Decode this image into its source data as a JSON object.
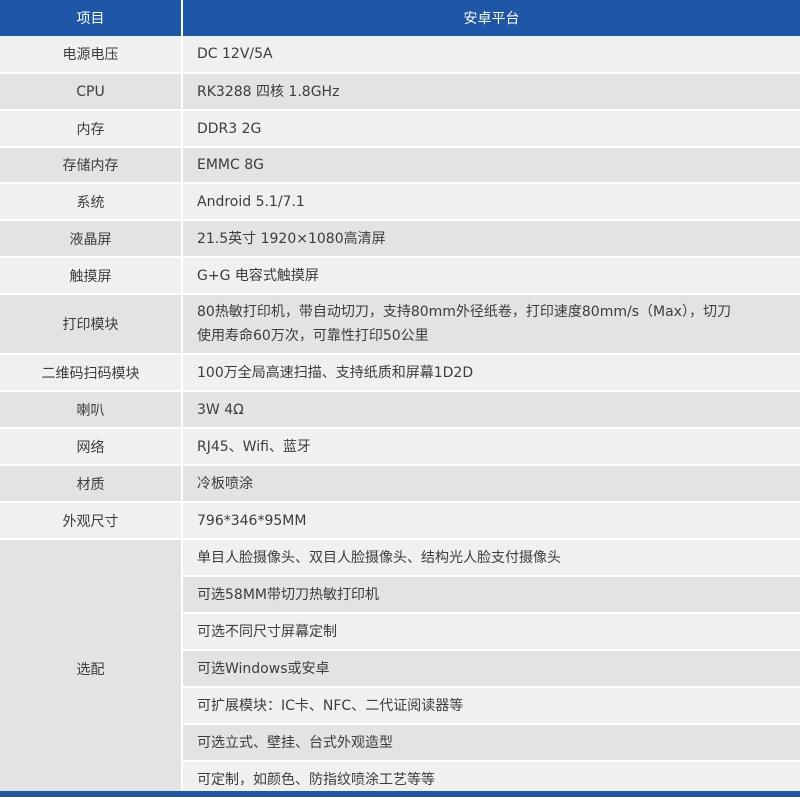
{
  "header": {
    "col1": "项目",
    "col2": "安卓平台"
  },
  "rows": [
    {
      "label": "电源电压",
      "value": "DC 12V/5A"
    },
    {
      "label": "CPU",
      "value": "RK3288 四核 1.8GHz"
    },
    {
      "label": "内存",
      "value": "DDR3 2G"
    },
    {
      "label": "存储内存",
      "value": "EMMC 8G"
    },
    {
      "label": "系统",
      "value": "Android 5.1/7.1"
    },
    {
      "label": "液晶屏",
      "value": "21.5英寸 1920×1080高清屏"
    },
    {
      "label": "触摸屏",
      "value": "G+G 电容式触摸屏"
    },
    {
      "label": "打印模块",
      "value_line1": "80热敏打印机，带自动切刀，支持80mm外径纸卷，打印速度80mm/s（Max），切刀",
      "value_line2": "使用寿命60万次，可靠性打印50公里"
    },
    {
      "label": "二维码扫码模块",
      "value": "100万全局高速扫描、支持纸质和屏幕1D2D"
    },
    {
      "label": "喇叭",
      "value": "3W 4Ω"
    },
    {
      "label": "网络",
      "value": "RJ45、Wifi、蓝牙"
    },
    {
      "label": "材质",
      "value": "冷板喷涂"
    },
    {
      "label": "外观尺寸",
      "value": "796*346*95MM"
    }
  ],
  "options": {
    "label": "选配",
    "items": [
      "单目人脸摄像头、双目人脸摄像头、结构光人脸支付摄像头",
      "可选58MM带切刀热敏打印机",
      "可选不同尺寸屏幕定制",
      "可选Windows或安卓",
      "可扩展模块：IC卡、NFC、二代证阅读器等",
      "可选立式、壁挂、台式外观造型",
      "可定制，如颜色、防指纹喷涂工艺等等"
    ]
  },
  "colors": {
    "header_bg": "#1e56a8",
    "row_light": "#f0f0f0",
    "row_dark": "#e3e3e3"
  }
}
